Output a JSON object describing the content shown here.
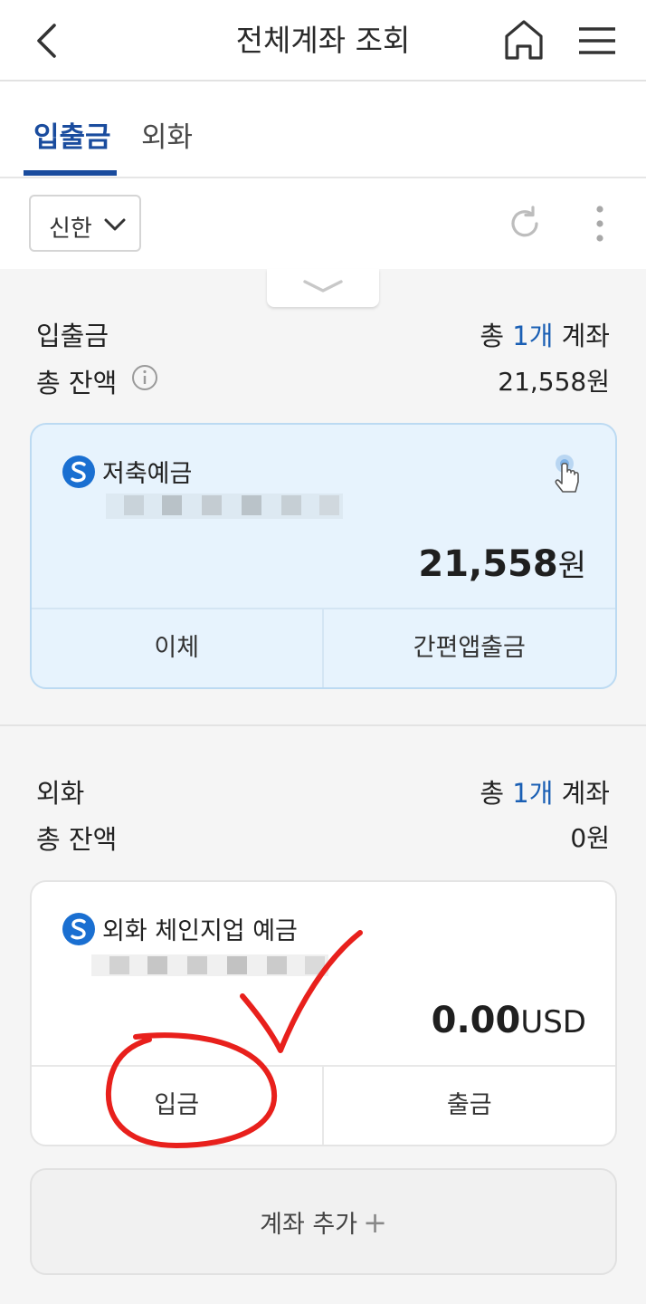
{
  "header": {
    "title": "전체계좌 조회",
    "back_icon": "chevron-left-icon",
    "home_icon": "home-icon",
    "menu_icon": "hamburger-menu-icon"
  },
  "tabs": [
    {
      "label": "입출금",
      "active": true
    },
    {
      "label": "외화",
      "active": false
    }
  ],
  "filter": {
    "bank_select_value": "신한"
  },
  "deposit_section": {
    "label": "입출금",
    "count_prefix": "총 ",
    "count": "1개",
    "count_suffix": " 계좌",
    "total_label": "총 잔액",
    "total_value": "21,558원",
    "account": {
      "name": "저축예금",
      "balance": "21,558",
      "unit": "원",
      "actions": [
        "이체",
        "간편앱출금"
      ]
    }
  },
  "fx_section": {
    "label": "외화",
    "count_prefix": "총 ",
    "count": "1개",
    "count_suffix": " 계좌",
    "total_label": "총 잔액",
    "total_value": "0원",
    "account": {
      "name": "외화 체인지업 예금",
      "balance": "0.00",
      "unit": "USD",
      "actions": [
        "입금",
        "출금"
      ]
    }
  },
  "add_account": {
    "label": "계좌 추가",
    "icon": "plus-icon"
  },
  "colors": {
    "accent": "#1a4c9e",
    "card_blue": "#e7f3fd",
    "annotation_red": "#e8201c"
  }
}
